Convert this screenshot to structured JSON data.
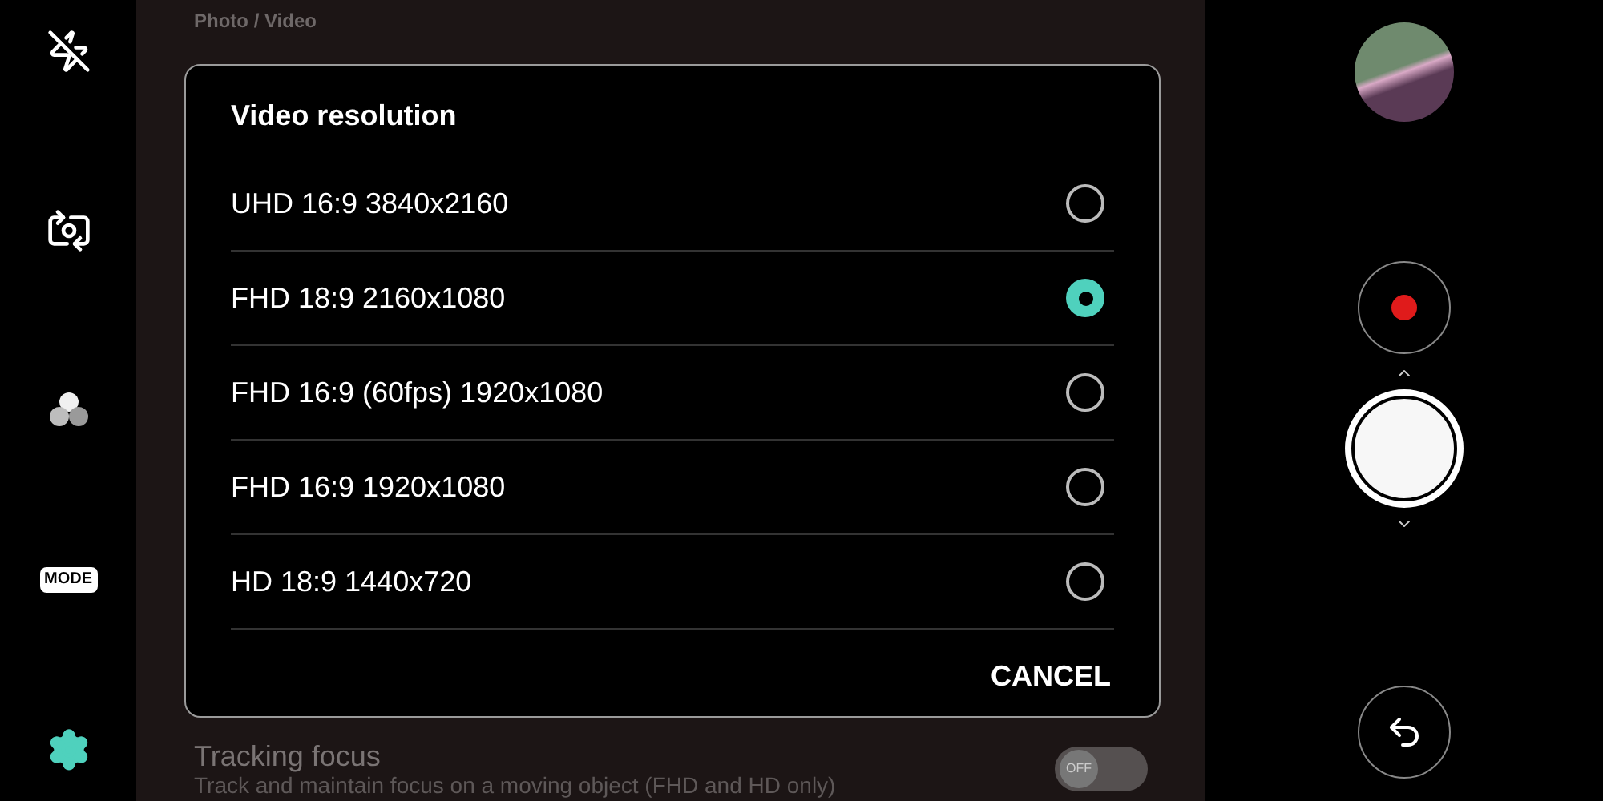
{
  "left_toolbar": {
    "mode_label": "MODE"
  },
  "settings": {
    "section": "Photo / Video",
    "bottom_item": {
      "title": "Tracking focus",
      "description": "Track and maintain focus on a moving object (FHD and HD only)",
      "toggle": {
        "on": false,
        "label": "OFF"
      }
    }
  },
  "dialog": {
    "title": "Video resolution",
    "options": [
      {
        "label": "UHD 16:9 3840x2160",
        "selected": false
      },
      {
        "label": "FHD 18:9 2160x1080",
        "selected": true
      },
      {
        "label": "FHD 16:9 (60fps) 1920x1080",
        "selected": false
      },
      {
        "label": "FHD 16:9 1920x1080",
        "selected": false
      },
      {
        "label": "HD 18:9 1440x720",
        "selected": false
      }
    ],
    "cancel": "CANCEL"
  }
}
